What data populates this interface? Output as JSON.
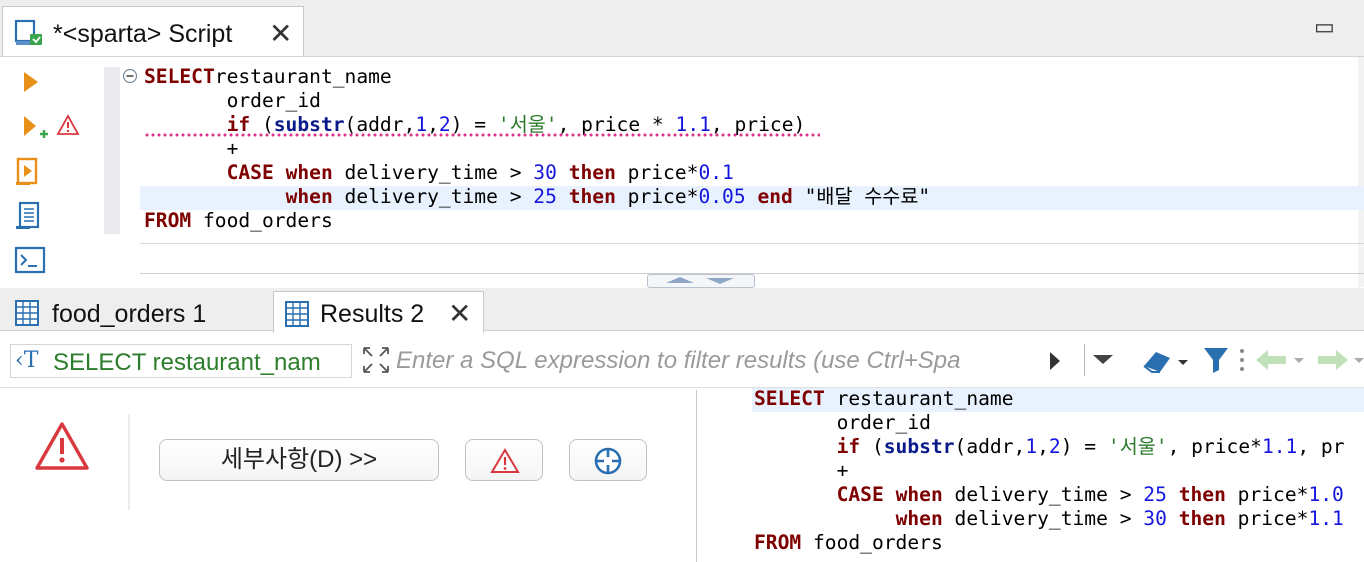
{
  "script_tab": {
    "title": "*<sparta> Script",
    "close": "✕"
  },
  "minimize": "▭",
  "editor": {
    "lines": [
      {
        "parts": [
          [
            "kw",
            "SELECT"
          ],
          [
            "",
            "restaurant_name"
          ]
        ],
        "prefix": ""
      },
      {
        "parts": [
          [
            "",
            "order_id"
          ]
        ],
        "prefix": "       "
      },
      {
        "parts": [
          [
            "kw",
            "if"
          ],
          [
            "",
            " ("
          ],
          [
            "fn",
            "substr"
          ],
          [
            "",
            "(addr,"
          ],
          [
            "num",
            "1"
          ],
          [
            "",
            ","
          ],
          [
            "num",
            "2"
          ],
          [
            "",
            ") = "
          ],
          [
            "str",
            "'서울'"
          ],
          [
            "",
            ", price * "
          ],
          [
            "num",
            "1.1"
          ],
          [
            "",
            ", price)"
          ]
        ],
        "prefix": "       "
      },
      {
        "parts": [
          [
            "",
            "+"
          ]
        ],
        "prefix": "       "
      },
      {
        "parts": [
          [
            "kw",
            "CASE"
          ],
          [
            "",
            " "
          ],
          [
            "kw",
            "when"
          ],
          [
            "",
            " delivery_time > "
          ],
          [
            "num",
            "30"
          ],
          [
            "",
            " "
          ],
          [
            "kw",
            "then"
          ],
          [
            "",
            " price*"
          ],
          [
            "num",
            "0.1"
          ]
        ],
        "prefix": "       "
      },
      {
        "parts": [
          [
            "kw",
            "when"
          ],
          [
            "",
            " delivery_time > "
          ],
          [
            "num",
            "25"
          ],
          [
            "",
            " "
          ],
          [
            "kw",
            "then"
          ],
          [
            "",
            " price*"
          ],
          [
            "num",
            "0.05"
          ],
          [
            "",
            " "
          ],
          [
            "kw",
            "end"
          ],
          [
            "",
            " \"배달 수수료\""
          ]
        ],
        "prefix": "            "
      },
      {
        "parts": [
          [
            "kw",
            "FROM"
          ],
          [
            "",
            " food_orders"
          ]
        ],
        "prefix": ""
      }
    ]
  },
  "result_tabs": {
    "food_orders": "food_orders 1",
    "results": "Results 2",
    "close": "✕"
  },
  "filter": {
    "query_label": "SELECT restaurant_nam",
    "placeholder": "Enter a SQL expression to filter results (use Ctrl+Spa"
  },
  "error_panel": {
    "details_button": "세부사항(D) >>"
  },
  "sql_panel": {
    "lines": [
      {
        "parts": [
          [
            "kw",
            "SELECT"
          ],
          [
            "",
            " restaurant_name"
          ]
        ],
        "prefix": ""
      },
      {
        "parts": [
          [
            "",
            "order_id"
          ]
        ],
        "prefix": "       "
      },
      {
        "parts": [
          [
            "kw",
            "if"
          ],
          [
            "",
            " ("
          ],
          [
            "fn",
            "substr"
          ],
          [
            "",
            "(addr,"
          ],
          [
            "num",
            "1"
          ],
          [
            "",
            ","
          ],
          [
            "num",
            "2"
          ],
          [
            "",
            ") = "
          ],
          [
            "str",
            "'서울'"
          ],
          [
            "",
            ", price*"
          ],
          [
            "num",
            "1.1"
          ],
          [
            "",
            ", pr"
          ]
        ],
        "prefix": "       "
      },
      {
        "parts": [
          [
            "",
            "+"
          ]
        ],
        "prefix": "       "
      },
      {
        "parts": [
          [
            "kw",
            "CASE"
          ],
          [
            "",
            " "
          ],
          [
            "kw",
            "when"
          ],
          [
            "",
            " delivery_time > "
          ],
          [
            "num",
            "25"
          ],
          [
            "",
            " "
          ],
          [
            "kw",
            "then"
          ],
          [
            "",
            " price*"
          ],
          [
            "num",
            "1.0"
          ]
        ],
        "prefix": "       "
      },
      {
        "parts": [
          [
            "kw",
            "when"
          ],
          [
            "",
            " delivery_time > "
          ],
          [
            "num",
            "30"
          ],
          [
            "",
            " "
          ],
          [
            "kw",
            "then"
          ],
          [
            "",
            " price*"
          ],
          [
            "num",
            "1.1"
          ]
        ],
        "prefix": "            "
      },
      {
        "parts": [
          [
            "kw",
            "FROM"
          ],
          [
            "",
            " food_orders"
          ]
        ],
        "prefix": ""
      }
    ]
  },
  "colors": {
    "keyword": "#7f0000",
    "number": "#1515e0",
    "string": "#2a7a2a",
    "error": "#d9393e",
    "accent": "#2a6fb0"
  },
  "icons": [
    "script-file-icon",
    "execute-statement-icon",
    "execute-in-new-tab-icon",
    "warning-icon",
    "execute-script-icon",
    "explain-plan-icon",
    "console-icon",
    "table-icon",
    "filter-icon",
    "eraser-icon",
    "back-arrow-icon",
    "forward-arrow-icon",
    "error-icon",
    "target-icon"
  ]
}
